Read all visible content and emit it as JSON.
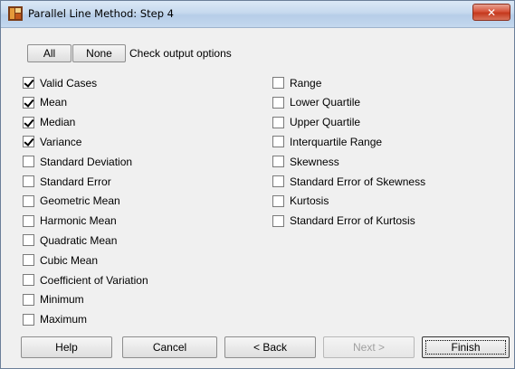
{
  "window": {
    "title": "Parallel Line Method: Step 4",
    "close_symbol": "✕"
  },
  "toolbar": {
    "all_label": "All",
    "none_label": "None",
    "check_label": "Check output options"
  },
  "left_options": [
    {
      "label": "Valid Cases",
      "checked": true
    },
    {
      "label": "Mean",
      "checked": true
    },
    {
      "label": "Median",
      "checked": true
    },
    {
      "label": "Variance",
      "checked": true
    },
    {
      "label": "Standard Deviation",
      "checked": false
    },
    {
      "label": "Standard Error",
      "checked": false
    },
    {
      "label": "Geometric Mean",
      "checked": false
    },
    {
      "label": "Harmonic Mean",
      "checked": false
    },
    {
      "label": "Quadratic Mean",
      "checked": false
    },
    {
      "label": "Cubic Mean",
      "checked": false
    },
    {
      "label": "Coefficient of Variation",
      "checked": false
    },
    {
      "label": "Minimum",
      "checked": false
    },
    {
      "label": "Maximum",
      "checked": false
    }
  ],
  "right_options": [
    {
      "label": "Range",
      "checked": false
    },
    {
      "label": "Lower Quartile",
      "checked": false
    },
    {
      "label": "Upper Quartile",
      "checked": false
    },
    {
      "label": "Interquartile Range",
      "checked": false
    },
    {
      "label": "Skewness",
      "checked": false
    },
    {
      "label": "Standard Error of Skewness",
      "checked": false
    },
    {
      "label": "Kurtosis",
      "checked": false
    },
    {
      "label": "Standard Error of Kurtosis",
      "checked": false
    }
  ],
  "footer": {
    "help_label": "Help",
    "cancel_label": "Cancel",
    "back_label": "< Back",
    "next_label": "Next >",
    "finish_label": "Finish"
  }
}
